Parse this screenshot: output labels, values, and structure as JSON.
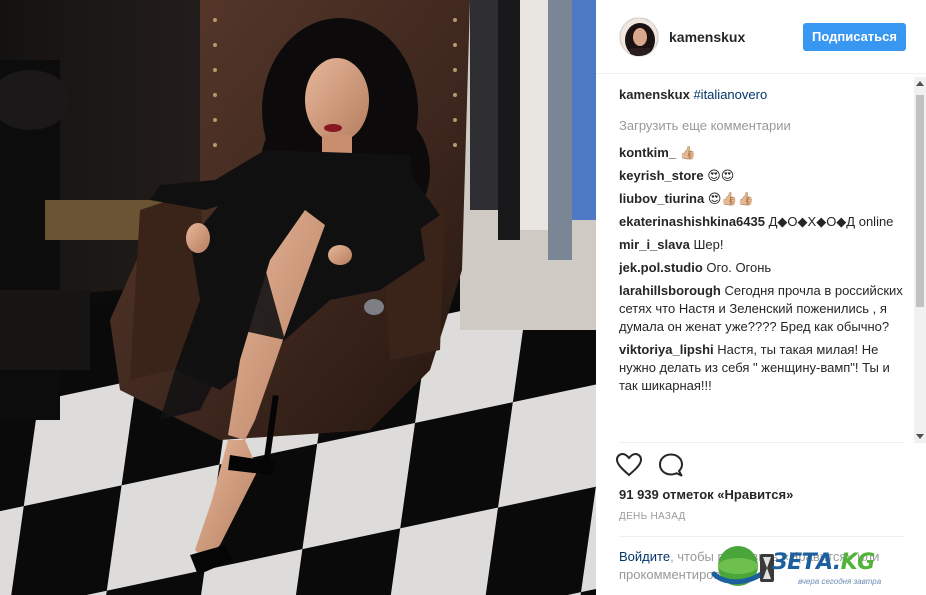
{
  "post": {
    "username": "kamenskux",
    "follow_label": "Подписаться"
  },
  "caption": {
    "username": "kamenskux",
    "hashtag": "#italianovero"
  },
  "load_more": "Загрузить еще комментарии",
  "comments": [
    {
      "user": "kontkim_",
      "text": "👍🏼"
    },
    {
      "user": "keyrish_store",
      "text": "😍😍"
    },
    {
      "user": "liubov_tiurina",
      "text": "😍👍🏼👍🏼"
    },
    {
      "user": "ekaterinashishkina6435",
      "text": "Д◆О◆Х◆О◆Д online"
    },
    {
      "user": "mir_i_slava",
      "text": "Шер!"
    },
    {
      "user": "jek.pol.studio",
      "text": "Ого. Огонь"
    },
    {
      "user": "larahillsborough",
      "text": "Сегодня прочла в российских сетях что Настя и Зеленский поженились , я думала он женат уже???? Бред как обычно?"
    },
    {
      "user": "viktoriya_lipshi",
      "text": "Настя, ты такая милая! Не нужно делать из себя \" женщину-вамп\"! Ты и так шикарная!!!"
    }
  ],
  "likes": "91 939 отметок «Нравится»",
  "timestamp": "ДЕНЬ НАЗАД",
  "login_prompt": {
    "login_link": "Войдите",
    "text_after_login": ", чтобы поставить «Нравится» или прокомментировать."
  },
  "icons": {
    "like": "heart-icon",
    "comment": "comment-icon",
    "scroll_up": "arrow-up-icon",
    "scroll_down": "arrow-down-icon"
  },
  "watermark": {
    "word": "ЗЕТА.",
    "suffix": "KG",
    "tagline": "вчера сегодня завтра"
  },
  "colors": {
    "follow_button": "#3897f0",
    "hashtag": "#003569",
    "muted_text": "#999999",
    "watermark_blue": "#1c5f9e",
    "watermark_green": "#52b33a"
  }
}
